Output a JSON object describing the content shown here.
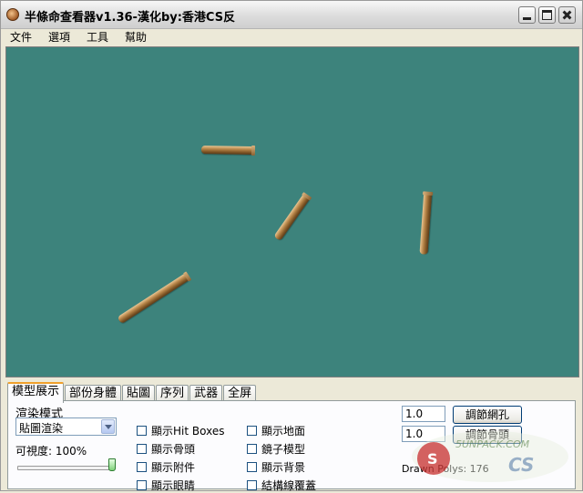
{
  "window": {
    "title": "半條命查看器v1.36-漢化by:香港CS反"
  },
  "menu": [
    "文件",
    "選項",
    "工具",
    "幫助"
  ],
  "viewport": {
    "background": "#3d837c"
  },
  "tabs": [
    "模型展示",
    "部份身體",
    "貼圖",
    "序列",
    "武器",
    "全屏"
  ],
  "active_tab": "模型展示",
  "model_panel": {
    "render_mode_label": "渲染模式",
    "render_mode_value": "貼圖渲染",
    "visibility_label": "可視度: 100%",
    "visibility_value": 1.0,
    "checkboxes_col1": [
      "顯示Hit Boxes",
      "顯示骨頭",
      "顯示附件",
      "顯示眼睛"
    ],
    "checkboxes_col2": [
      "顯示地面",
      "鏡子模型",
      "顯示背景",
      "結構線覆蓋"
    ],
    "grid_input_value": "1.0",
    "grid_button_label": "調節網孔",
    "bone_input_value": "1.0",
    "bone_button_label": "調節骨頭",
    "drawn_polys_label": "Drawn Polys: 176"
  },
  "watermark": {
    "text1": "5UNPACK.COM",
    "text2": "CS"
  }
}
